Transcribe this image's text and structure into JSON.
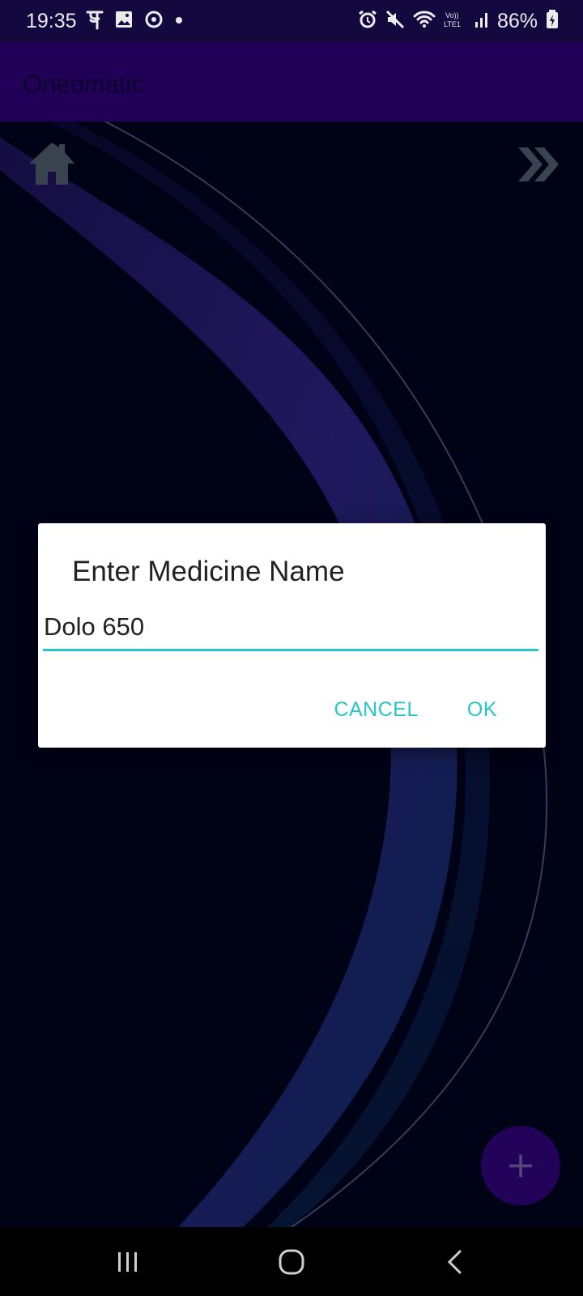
{
  "status_bar": {
    "time": "19:35",
    "battery_text": "86%",
    "left_icons": [
      "phonepe-icon",
      "gallery-icon",
      "sync-icon",
      "dot-icon"
    ],
    "right_icons": [
      "alarm-icon",
      "mute-icon",
      "wifi-icon",
      "volte-icon",
      "signal-icon",
      "battery-icon"
    ],
    "volte_text": "Vo)) LTE1"
  },
  "app_bar": {
    "title": "Oneomatic"
  },
  "toolbar": {
    "home_icon": "home-icon",
    "forward_icon": "double-chevron-right-icon"
  },
  "dialog": {
    "title": "Enter Medicine Name",
    "input_value": "Dolo 650",
    "cancel_label": "CANCEL",
    "ok_label": "OK"
  },
  "fab": {
    "label": "+"
  },
  "nav_bar": {
    "icons": [
      "recents-icon",
      "home-circle-icon",
      "back-icon"
    ]
  },
  "colors": {
    "status_bar": "#150a45",
    "app_bar": "#260060",
    "accent": "#26c6c6",
    "fab": "#260462",
    "background": "#010318"
  }
}
